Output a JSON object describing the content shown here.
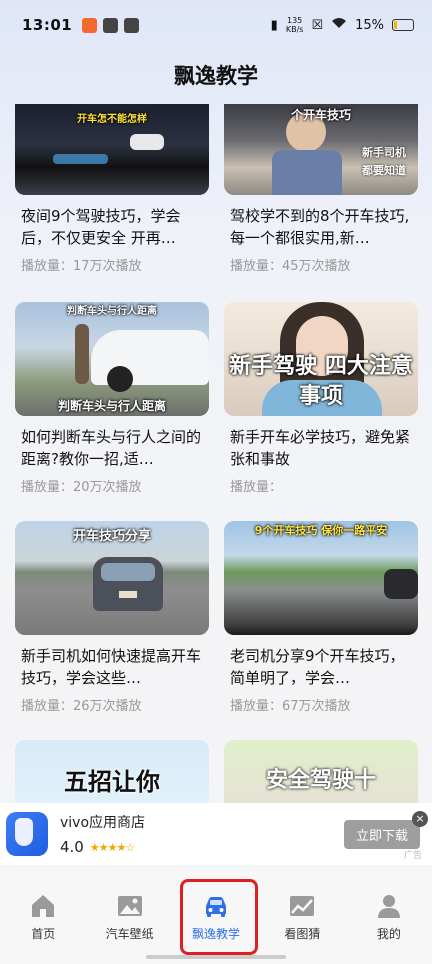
{
  "status_bar": {
    "time": "13:01",
    "net_speed_value": "135",
    "net_speed_unit": "KB/s",
    "battery": "15%",
    "battery_level": 0.15
  },
  "page": {
    "title": "飘逸教学"
  },
  "cards": [
    {
      "caption": "开车怎不能怎样",
      "title": "夜间9个驾驶技巧，学会后，不仅更安全 开再…",
      "views_label": "播放量：",
      "views": "17万次播放"
    },
    {
      "caption": "个开车技巧",
      "title": "驾校学不到的8个开车技巧,每一个都很实用,新…",
      "views_label": "播放量：",
      "views": "45万次播放"
    },
    {
      "caption": "判断车头与行人距离",
      "title": "如何判断车头与行人之间的距离?教你一招,适…",
      "views_label": "播放量：",
      "views": "20万次播放"
    },
    {
      "caption": "新手驾驶 四大注意事项",
      "title": "新手开车必学技巧，避免紧张和事故",
      "views_label": "播放量：",
      "views": ""
    },
    {
      "caption": "开车技巧分享",
      "title": "新手司机如何快速提高开车技巧，学会这些…",
      "views_label": "播放量：",
      "views": "26万次播放"
    },
    {
      "caption": "9个开车技巧 保你一路平安",
      "title": "老司机分享9个开车技巧，简单明了，学会…",
      "views_label": "播放量：",
      "views": "67万次播放"
    },
    {
      "caption": "五招让你",
      "title": "",
      "views_label": "",
      "views": ""
    },
    {
      "caption": "安全驾驶十",
      "title": "",
      "views_label": "",
      "views": ""
    }
  ],
  "ad": {
    "app_name": "vivo应用商店",
    "rating": "4.0",
    "stars": "★★★★☆",
    "download_label": "立即下载",
    "close_symbol": "×",
    "tag": "广告"
  },
  "tabs": [
    {
      "label": "首页",
      "icon": "house-icon",
      "active": false
    },
    {
      "label": "汽车壁纸",
      "icon": "image-icon",
      "active": false
    },
    {
      "label": "飘逸教学",
      "icon": "car-icon",
      "active": true
    },
    {
      "label": "看图猜",
      "icon": "photo-chart-icon",
      "active": false
    },
    {
      "label": "我的",
      "icon": "person-icon",
      "active": false
    }
  ],
  "colors": {
    "accent": "#2f6fe8",
    "highlight_box": "#e02020",
    "views_text": "#999999"
  }
}
